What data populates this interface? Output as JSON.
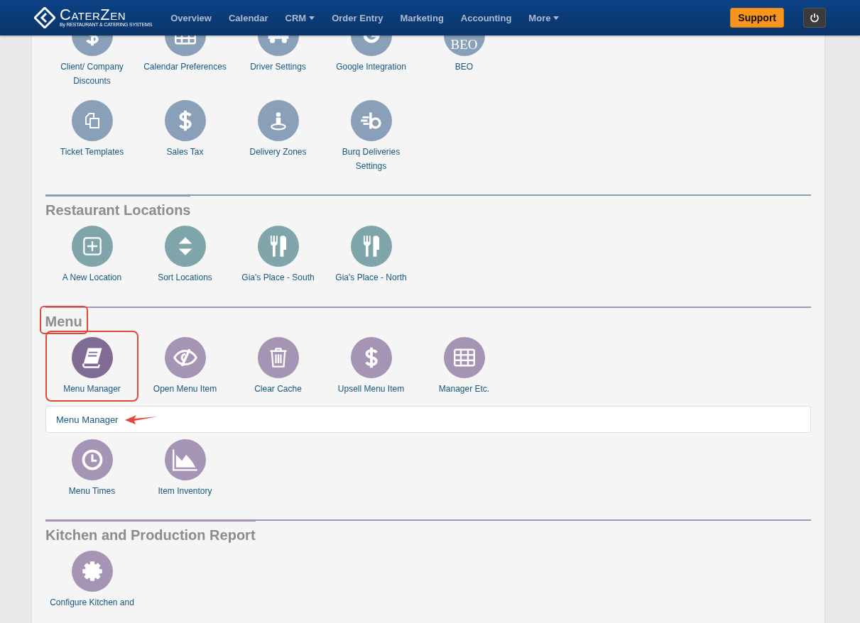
{
  "navbar": {
    "logo": {
      "name": "CaterZen",
      "tagline": "By RESTAURANT & CATERING SYSTEMS"
    },
    "items": [
      {
        "label": "Overview",
        "dropdown": false
      },
      {
        "label": "Calendar",
        "dropdown": false
      },
      {
        "label": "CRM",
        "dropdown": true
      },
      {
        "label": "Order Entry",
        "dropdown": false
      },
      {
        "label": "Marketing",
        "dropdown": false
      },
      {
        "label": "Accounting",
        "dropdown": false
      },
      {
        "label": "More",
        "dropdown": true
      }
    ],
    "support_button": "Support"
  },
  "sections": [
    {
      "color": "#8a9fb8",
      "blocks": [
        {
          "kind": "tiles",
          "tiles": [
            {
              "label": "Client/ Company Discounts",
              "kind": "dollar",
              "selected": false,
              "highlighted": false
            },
            {
              "label": "Calendar Preferences",
              "kind": "grid",
              "selected": false,
              "highlighted": false
            },
            {
              "label": "Driver Settings",
              "kind": "truck",
              "selected": false,
              "highlighted": false
            },
            {
              "label": "Google Integration",
              "kind": "google",
              "selected": false,
              "highlighted": false
            },
            {
              "label": "BEO",
              "kind": "text",
              "icon_text": "BEO",
              "selected": false,
              "highlighted": false
            }
          ]
        },
        {
          "kind": "tiles",
          "tiles": [
            {
              "label": "Ticket Templates",
              "kind": "copy",
              "selected": false,
              "highlighted": false
            },
            {
              "label": "Sales Tax",
              "kind": "dollar",
              "selected": false,
              "highlighted": false
            },
            {
              "label": "Delivery Zones",
              "kind": "pin",
              "selected": false,
              "highlighted": false
            },
            {
              "label": "Burq Deliveries Settings",
              "kind": "burq",
              "selected": false,
              "highlighted": false
            }
          ]
        }
      ]
    },
    {
      "heading": "Restaurant Locations",
      "highlighted": false,
      "color": "#7fa4a9",
      "blocks": [
        {
          "kind": "tiles",
          "tiles": [
            {
              "label": "A New Location",
              "kind": "plus",
              "selected": false,
              "highlighted": false
            },
            {
              "label": "Sort Locations",
              "kind": "sort",
              "selected": false,
              "highlighted": false
            },
            {
              "label": "Gia's Place - South",
              "kind": "utensils",
              "selected": false,
              "highlighted": false
            },
            {
              "label": "Gia's Place - North",
              "kind": "utensils",
              "selected": false,
              "highlighted": false
            }
          ]
        }
      ]
    },
    {
      "heading": "Menu",
      "highlighted": true,
      "color": "#a594b4",
      "blocks": [
        {
          "kind": "tiles",
          "tiles": [
            {
              "label": "Menu Manager",
              "kind": "book",
              "selected": true,
              "highlighted": true
            },
            {
              "label": "Open Menu Item",
              "kind": "hidden",
              "selected": false,
              "highlighted": false
            },
            {
              "label": "Clear Cache",
              "kind": "trash",
              "selected": false,
              "highlighted": false
            },
            {
              "label": "Upsell Menu Item",
              "kind": "dollar",
              "selected": false,
              "highlighted": false
            },
            {
              "label": "Manager Etc.",
              "kind": "grid",
              "selected": false,
              "highlighted": false
            }
          ]
        },
        {
          "kind": "info",
          "text": "Menu Manager",
          "arrow": true
        },
        {
          "kind": "tiles",
          "tiles": [
            {
              "label": "Menu Times",
              "kind": "clock",
              "selected": false,
              "highlighted": false
            },
            {
              "label": "Item Inventory",
              "kind": "chart",
              "selected": false,
              "highlighted": false
            }
          ]
        }
      ]
    },
    {
      "heading": "Kitchen and Production Report",
      "highlighted": false,
      "color": "#a594b4",
      "blocks": [
        {
          "kind": "tiles",
          "tiles": [
            {
              "label": "Configure Kitchen and",
              "kind": "gear",
              "selected": false,
              "highlighted": false
            }
          ]
        }
      ]
    }
  ]
}
